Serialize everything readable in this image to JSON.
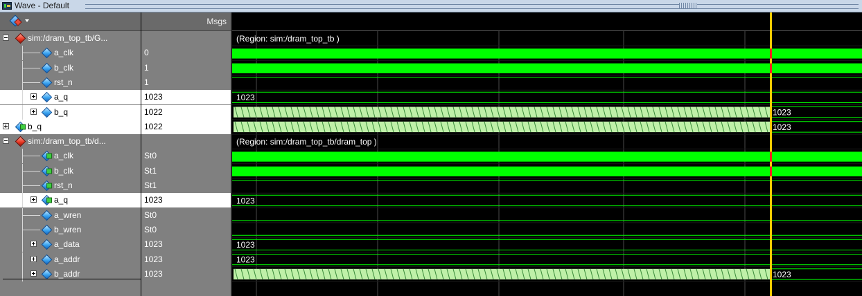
{
  "window": {
    "title": "Wave - Default"
  },
  "header": {
    "msgs_label": "Msgs"
  },
  "signals": [
    {
      "name": "sim:/dram_top_tb/G...",
      "value": "",
      "kind": "group",
      "depth": 0,
      "expander": "minus",
      "selected": false
    },
    {
      "name": "a_clk",
      "value": "0",
      "kind": "clock",
      "depth": 1,
      "expander": "",
      "selected": false
    },
    {
      "name": "b_clk",
      "value": "1",
      "kind": "clock",
      "depth": 1,
      "expander": "",
      "selected": false
    },
    {
      "name": "rst_n",
      "value": "1",
      "kind": "high",
      "depth": 1,
      "expander": "",
      "selected": false
    },
    {
      "name": "a_q",
      "value": "1023",
      "kind": "bus_const",
      "depth": 1,
      "expander": "plus",
      "selected": true
    },
    {
      "name": "b_q",
      "value": "1022",
      "kind": "bus_toggle",
      "depth": 1,
      "expander": "plus",
      "selected": true
    },
    {
      "name": "b_q",
      "value": "1022",
      "kind": "bus_toggle",
      "depth": 0,
      "expander": "plus",
      "selected": true,
      "io": true
    },
    {
      "name": "sim:/dram_top_tb/d...",
      "value": "",
      "kind": "group",
      "depth": 0,
      "expander": "minus",
      "selected": false
    },
    {
      "name": "a_clk",
      "value": "St0",
      "kind": "clock",
      "depth": 1,
      "expander": "",
      "selected": false,
      "io": true
    },
    {
      "name": "b_clk",
      "value": "St1",
      "kind": "clock",
      "depth": 1,
      "expander": "",
      "selected": false,
      "io": true
    },
    {
      "name": "rst_n",
      "value": "St1",
      "kind": "high",
      "depth": 1,
      "expander": "",
      "selected": false,
      "io": true
    },
    {
      "name": "a_q",
      "value": "1023",
      "kind": "bus_const",
      "depth": 1,
      "expander": "plus",
      "selected": true,
      "io": true
    },
    {
      "name": "a_wren",
      "value": "St0",
      "kind": "low",
      "depth": 1,
      "expander": "",
      "selected": false
    },
    {
      "name": "b_wren",
      "value": "St0",
      "kind": "low",
      "depth": 1,
      "expander": "",
      "selected": false
    },
    {
      "name": "a_data",
      "value": "1023",
      "kind": "bus_const",
      "depth": 1,
      "expander": "plus",
      "selected": false
    },
    {
      "name": "a_addr",
      "value": "1023",
      "kind": "bus_const",
      "depth": 1,
      "expander": "plus",
      "selected": false
    },
    {
      "name": "b_addr",
      "value": "1023",
      "kind": "bus_toggle",
      "depth": 1,
      "expander": "plus",
      "selected": false
    }
  ],
  "waveform": {
    "region_labels": [
      "(Region: sim:/dram_top_tb )",
      "(Region: sim:/dram_top_tb/dram_top )"
    ],
    "bus_const_label": "1023",
    "bus_toggle_end_label": "1023",
    "colors": {
      "signal": "#00ff00",
      "bus_fill": "#bff0a8",
      "bus_stripe": "#3a8a3a",
      "cursor": "#ffcc00",
      "cursor_clock": "#ff2020",
      "grid": "#4a4a4a",
      "wave_bg": "#000000",
      "pane_bg": "#808080",
      "selected_row": "#ffffff"
    }
  }
}
